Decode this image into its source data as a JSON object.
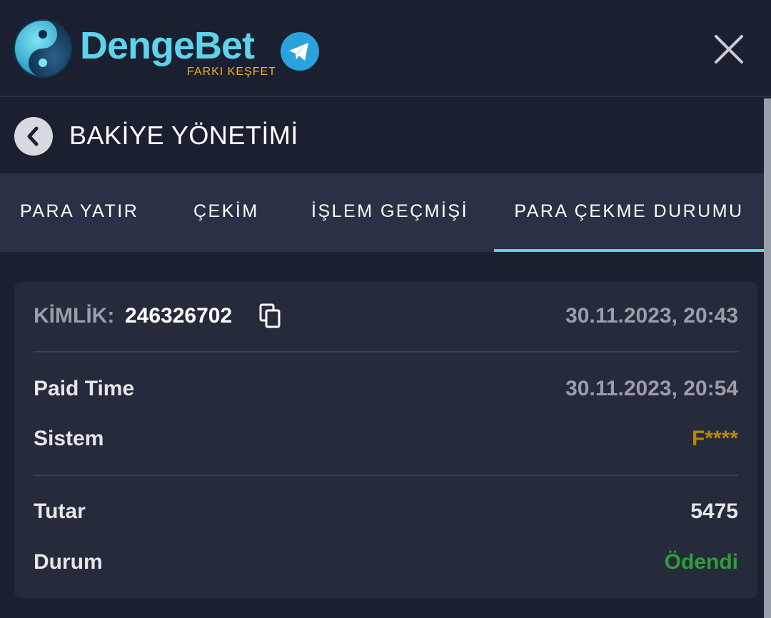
{
  "header": {
    "brand_name": "DengeBet",
    "tagline": "FARKI KEŞFET",
    "logo_icon": "yin-yang-ball-icon",
    "telegram_icon": "telegram-icon",
    "close_icon": "close-icon"
  },
  "title_bar": {
    "back_icon": "chevron-left-icon",
    "title": "BAKİYE YÖNETİMİ"
  },
  "tabs": [
    {
      "label": "PARA YATIR",
      "active": false
    },
    {
      "label": "ÇEKİM",
      "active": false
    },
    {
      "label": "İŞLEM GEÇMİŞİ",
      "active": false
    },
    {
      "label": "PARA ÇEKME DURUMU",
      "active": true
    }
  ],
  "card": {
    "id_label": "KİMLİK:",
    "id_value": "246326702",
    "created_at": "30.11.2023, 20:43",
    "paid_time_label": "Paid Time",
    "paid_time_value": "30.11.2023, 20:54",
    "system_label": "Sistem",
    "system_value": "F****",
    "amount_label": "Tutar",
    "amount_value": "5475",
    "status_label": "Durum",
    "status_value": "Ödendi"
  },
  "colors": {
    "background": "#1b2030",
    "card": "#262b3b",
    "tabs_bg": "#2a3045",
    "accent": "#5fd3ec",
    "brand_yellow": "#e8b21e",
    "system_value": "#b8860b",
    "status_paid": "#2e9e3a"
  }
}
